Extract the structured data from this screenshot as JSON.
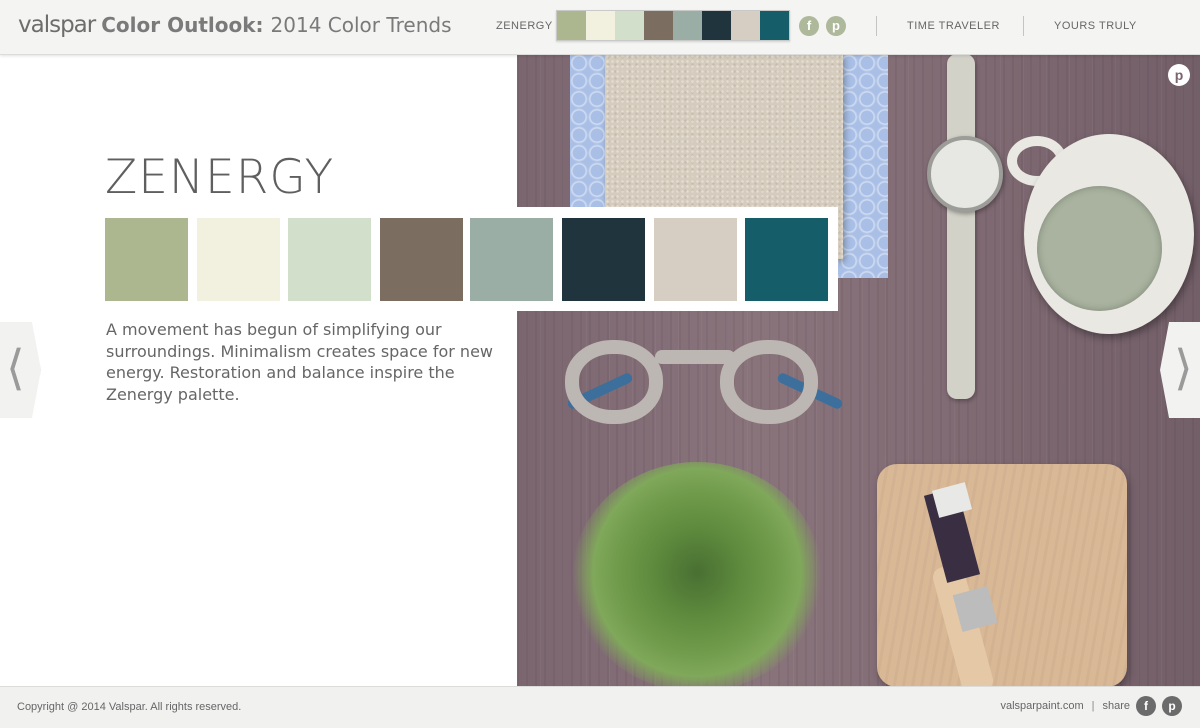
{
  "header": {
    "logo": "valspar",
    "title_bold": "Color Outlook:",
    "title_rest": "2014 Color Trends",
    "current_palette_label": "ZENERGY",
    "social": {
      "facebook_icon": "f",
      "pinterest_icon": "p"
    },
    "nav": [
      {
        "label": "TIME TRAVELER"
      },
      {
        "label": "YOURS TRULY"
      }
    ]
  },
  "palette": {
    "title": "ZENERGY",
    "description": "A movement has begun of simplifying our surroundings. Minimalism creates space for new energy. Restoration and balance inspire the Zenergy palette.",
    "swatches": [
      "#acb78f",
      "#f2f1e0",
      "#d1dfcb",
      "#7b6e61",
      "#9aaea5",
      "#1f343c",
      "#d6cdc3",
      "#145d69"
    ]
  },
  "photo": {
    "pin_icon": "p",
    "subject": "flat-lay of fabric, patterned tile, watch, mug, glasses, succulent, phone case and paintbrush on wood"
  },
  "arrows": {
    "left_glyph": "⟨",
    "right_glyph": "⟩"
  },
  "footer": {
    "copyright": "Copyright @ 2014 Valspar. All rights reserved.",
    "site": "valsparpaint.com",
    "separator": "|",
    "share_label": "share",
    "facebook_icon": "f",
    "pinterest_icon": "p"
  }
}
